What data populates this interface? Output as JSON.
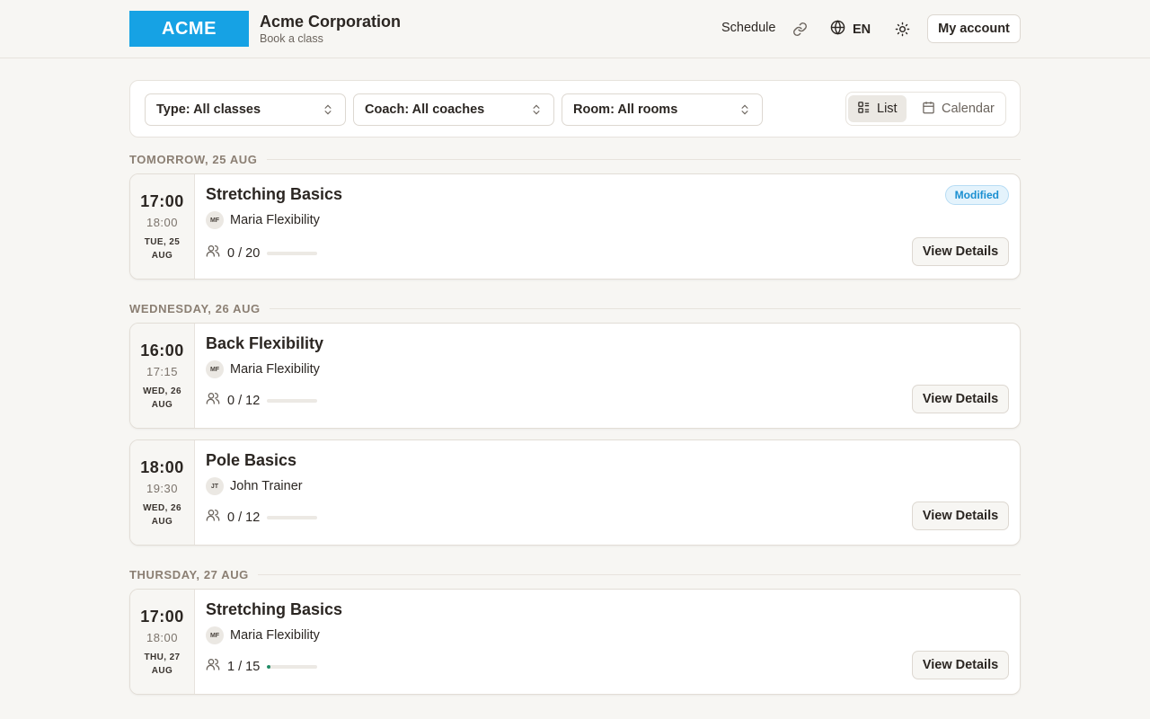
{
  "header": {
    "logo_text": "ACME",
    "org_name": "Acme Corporation",
    "org_subtitle": "Book a class",
    "nav_schedule": "Schedule",
    "language": "EN",
    "account_label": "My account",
    "brand_color": "#16a2e4"
  },
  "filters": {
    "type": "Type: All classes",
    "coach": "Coach: All coaches",
    "room": "Room: All rooms",
    "view_list": "List",
    "view_calendar": "Calendar",
    "active_view": "List"
  },
  "days": [
    {
      "label": "TOMORROW, 25 AUG",
      "classes": [
        {
          "start": "17:00",
          "end": "18:00",
          "date": "TUE, 25 AUG",
          "title": "Stretching Basics",
          "coach_initials": "MF",
          "coach": "Maria Flexibility",
          "booked": "0",
          "capacity": "20",
          "fill": 0,
          "badge": "Modified",
          "action": "View Details"
        }
      ]
    },
    {
      "label": "WEDNESDAY, 26 AUG",
      "classes": [
        {
          "start": "16:00",
          "end": "17:15",
          "date": "WED, 26 AUG",
          "title": "Back Flexibility",
          "coach_initials": "MF",
          "coach": "Maria Flexibility",
          "booked": "0",
          "capacity": "12",
          "fill": 0,
          "action": "View Details"
        },
        {
          "start": "18:00",
          "end": "19:30",
          "date": "WED, 26 AUG",
          "title": "Pole Basics",
          "coach_initials": "JT",
          "coach": "John Trainer",
          "booked": "0",
          "capacity": "12",
          "fill": 0,
          "action": "View Details"
        }
      ]
    },
    {
      "label": "THURSDAY, 27 AUG",
      "classes": [
        {
          "start": "17:00",
          "end": "18:00",
          "date": "THU, 27 AUG",
          "title": "Stretching Basics",
          "coach_initials": "MF",
          "coach": "Maria Flexibility",
          "booked": "1",
          "capacity": "15",
          "fill": 0.0667,
          "action": "View Details"
        }
      ]
    }
  ],
  "colors": {
    "accent": "#16a2e4",
    "progress": "#1f8b65",
    "badge_text": "#1a8fd1"
  }
}
